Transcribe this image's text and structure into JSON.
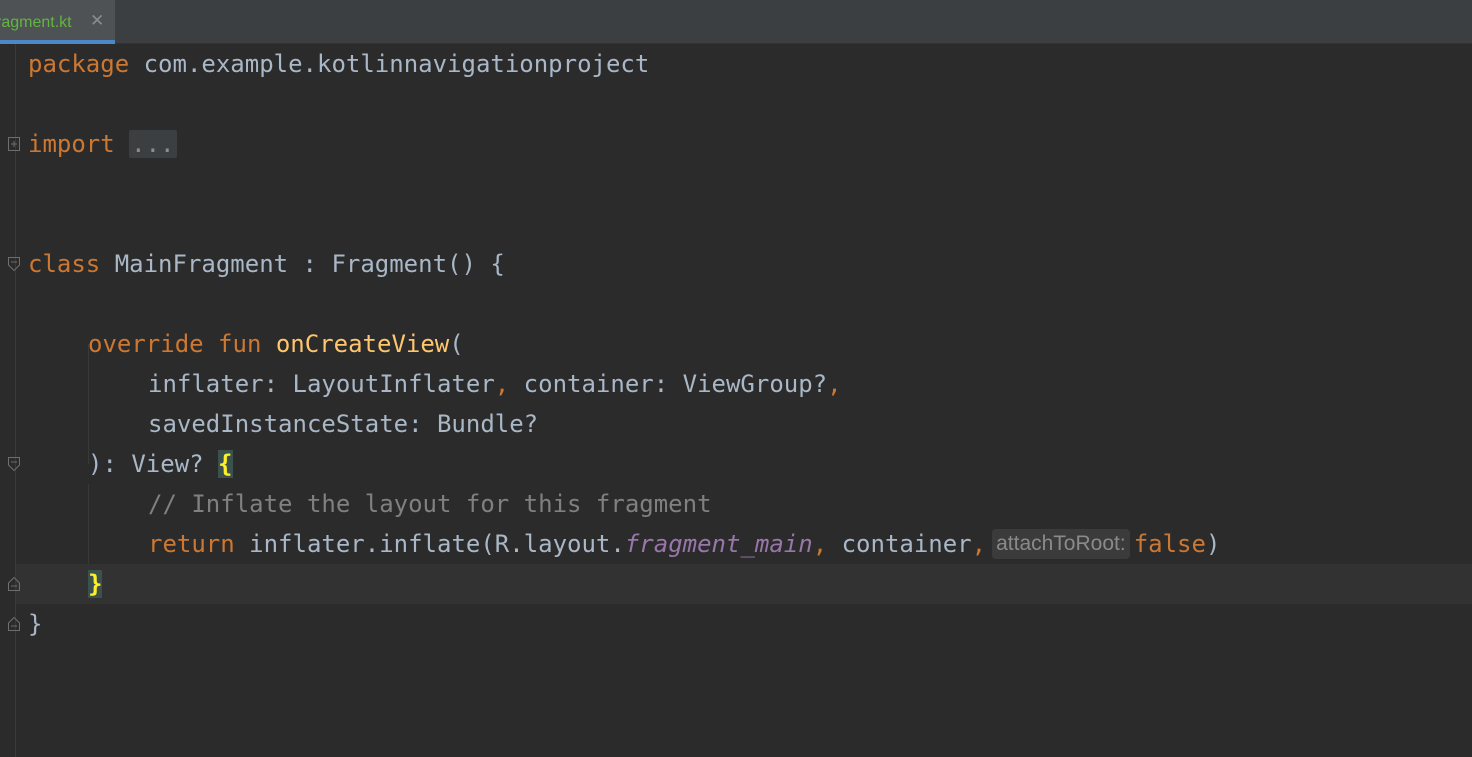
{
  "tab": {
    "label": "ragment.kt",
    "close": "✕"
  },
  "code": {
    "line1": {
      "kw": "package",
      "rest": " com.example.kotlinnavigationproject"
    },
    "line3": {
      "kw": "import",
      "placeholder": "..."
    },
    "line6": {
      "kw": "class",
      "rest": " MainFragment : Fragment() {"
    },
    "line8": {
      "kw1": "override",
      "kw2": "fun",
      "fn": "onCreateView",
      "rest": "("
    },
    "line9": {
      "a": "inflater: LayoutInflater",
      "comma1": ",",
      "b": " container: ViewGroup?",
      "comma2": ","
    },
    "line10": {
      "a": "savedInstanceState: Bundle?"
    },
    "line11": {
      "a": "): View? ",
      "brace": "{"
    },
    "line12": {
      "comment": "// Inflate the layout for this fragment"
    },
    "line13": {
      "kw": "return",
      "a": " inflater.inflate(R.layout.",
      "field": "fragment_main",
      "comma1": ",",
      "b": " container",
      "comma2": ",",
      "hint": "attachToRoot:",
      "val": "false",
      "close": ")"
    },
    "line14": {
      "brace": "}"
    },
    "line15": {
      "brace": "}"
    }
  }
}
